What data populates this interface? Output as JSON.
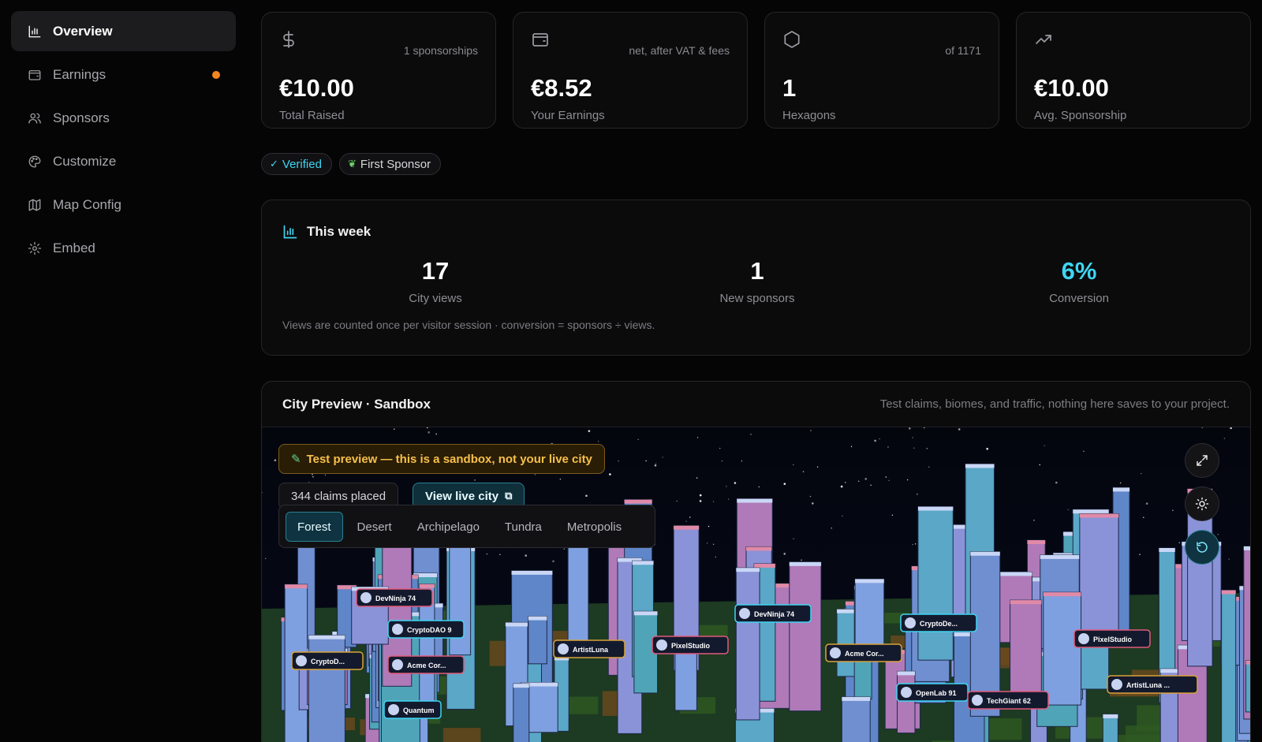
{
  "sidebar": {
    "items": [
      {
        "label": "Overview",
        "icon": "bar-chart-icon",
        "active": true
      },
      {
        "label": "Earnings",
        "icon": "wallet-icon",
        "notification_dot": "#f5841f"
      },
      {
        "label": "Sponsors",
        "icon": "users-icon"
      },
      {
        "label": "Customize",
        "icon": "palette-icon"
      },
      {
        "label": "Map Config",
        "icon": "map-icon"
      },
      {
        "label": "Embed",
        "icon": "gear-icon"
      }
    ]
  },
  "stats": [
    {
      "icon": "dollar-icon",
      "note": "1 sponsorships",
      "value": "€10.00",
      "label": "Total Raised"
    },
    {
      "icon": "wallet-icon",
      "note": "net, after VAT & fees",
      "value": "€8.52",
      "label": "Your Earnings"
    },
    {
      "icon": "hexagon-icon",
      "note": "of 1171",
      "value": "1",
      "label": "Hexagons"
    },
    {
      "icon": "trending-up-icon",
      "note": "",
      "value": "€10.00",
      "label": "Avg. Sponsorship"
    }
  ],
  "badges": {
    "verified": "Verified",
    "first_sponsor": "First Sponsor"
  },
  "week": {
    "title": "This week",
    "metrics": [
      {
        "value": "17",
        "label": "City views"
      },
      {
        "value": "1",
        "label": "New sponsors"
      },
      {
        "value": "6%",
        "label": "Conversion"
      }
    ],
    "footnote": "Views are counted once per visitor session · conversion = sponsors ÷ views."
  },
  "city": {
    "title": "City Preview · Sandbox",
    "hint": "Test claims, biomes, and traffic, nothing here saves to your project.",
    "banner": "Test preview — this is a sandbox, not your live city",
    "claims": "344 claims placed",
    "live_button": "View live city",
    "biomes": [
      "Forest",
      "Desert",
      "Archipelago",
      "Tundra",
      "Metropolis"
    ],
    "active_biome": "Forest",
    "tags": [
      "CryptoDAO 9",
      "Acme Cor...",
      "CryptoD...",
      "DevNinja 74",
      "PixelStudio",
      "Acme Cor...",
      "OpenLab 91",
      "TechGiant 62",
      "ArtistLuna ...",
      "CryptoDe...",
      "PixelStudio",
      "ArtistLuna",
      "Quantum",
      "DevNinja 74"
    ]
  },
  "colors": {
    "accent": "#3fd5f2",
    "warning": "#f6c04b",
    "notification": "#f5841f"
  }
}
